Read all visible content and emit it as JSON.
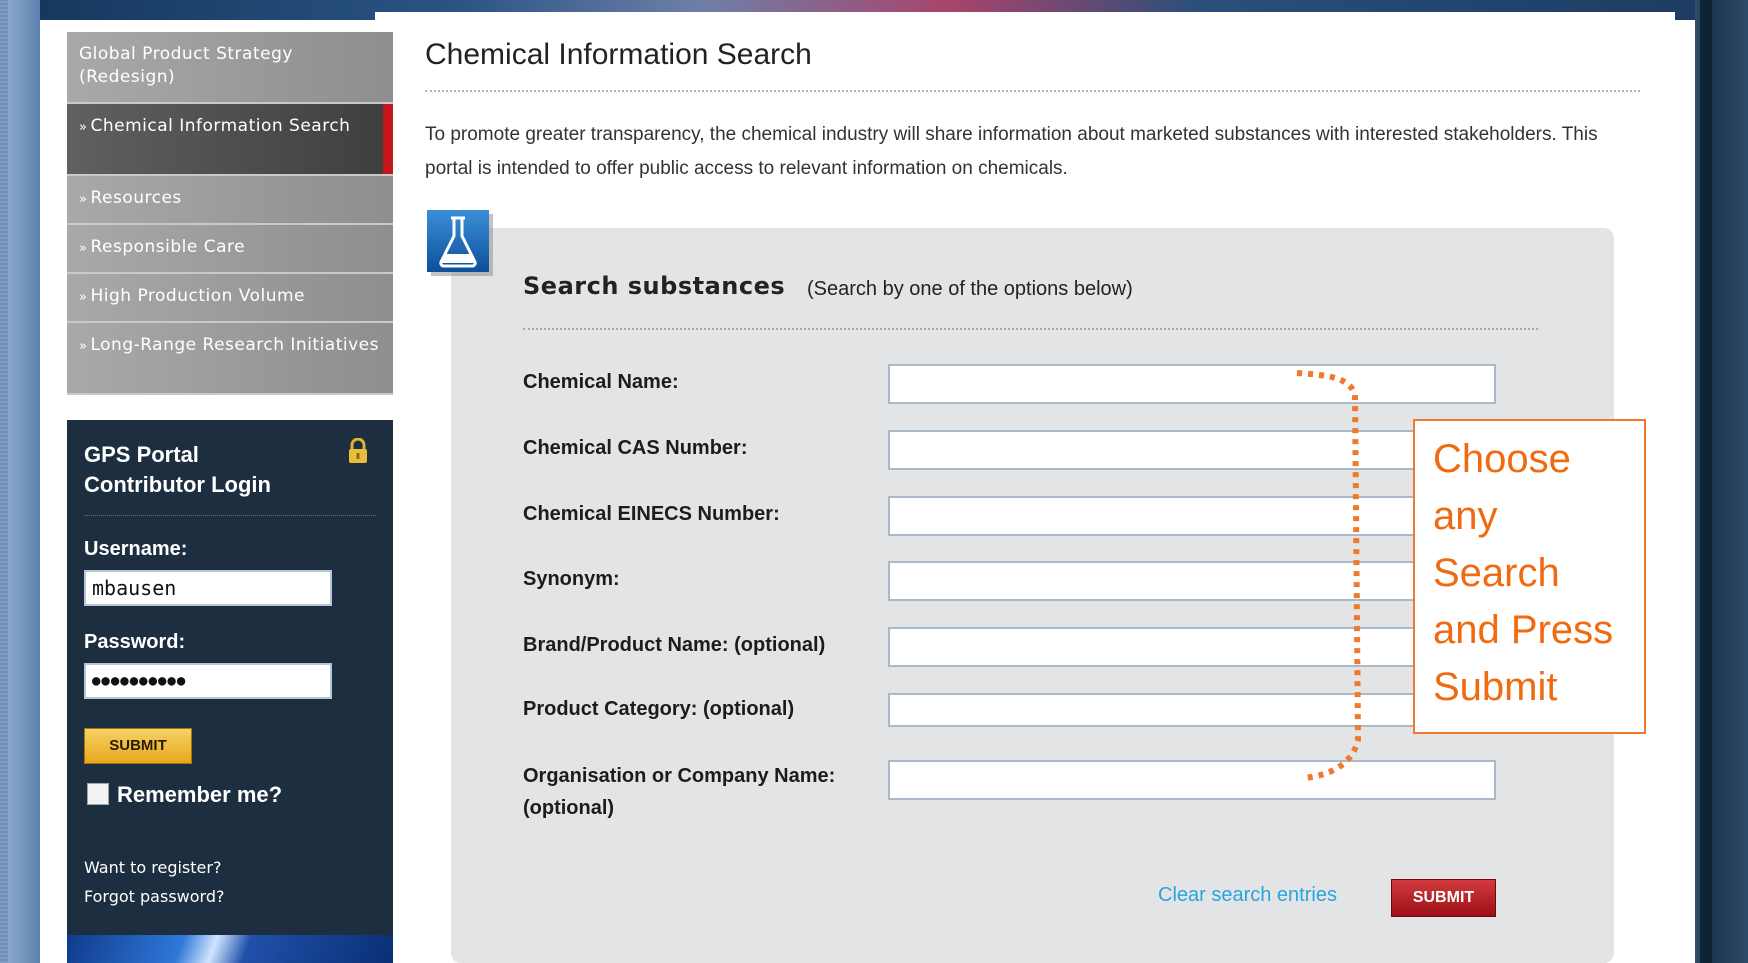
{
  "nav": {
    "items": [
      {
        "label": "Global Product Strategy (Redesign)",
        "arrow": false,
        "active": false
      },
      {
        "label": "Chemical Information Search",
        "arrow": true,
        "active": true
      },
      {
        "label": "Resources",
        "arrow": true,
        "active": false
      },
      {
        "label": "Responsible Care",
        "arrow": true,
        "active": false
      },
      {
        "label": "High Production Volume",
        "arrow": true,
        "active": false
      },
      {
        "label": "Long-Range Research Initiatives",
        "arrow": true,
        "active": false
      }
    ]
  },
  "login": {
    "title_line1": "GPS Portal",
    "title_line2": "Contributor Login",
    "username_label": "Username:",
    "username_value": "mbausen",
    "password_label": "Password:",
    "password_value": "●●●●●●●●●●",
    "submit_label": "SUBMIT",
    "remember_label": "Remember me?",
    "register_link": "Want to register?",
    "forgot_link": "Forgot password?"
  },
  "main": {
    "title": "Chemical Information Search",
    "intro": "To promote greater transparency, the chemical industry will share information about marketed substances with interested stakeholders. This portal is intended to offer public access to relevant information on chemicals.",
    "panel_title": "Search substances",
    "panel_subtitle": "(Search by one of the options below)",
    "fields": [
      {
        "label": "Chemical Name:",
        "value": ""
      },
      {
        "label": "Chemical CAS Number:",
        "value": ""
      },
      {
        "label": "Chemical EINECS Number:",
        "value": ""
      },
      {
        "label": "Synonym:",
        "value": ""
      },
      {
        "label": "Brand/Product Name: (optional)",
        "value": ""
      },
      {
        "label": "Product Category: (optional)",
        "value": ""
      },
      {
        "label": "Organisation or Company Name:",
        "label_line2": "(optional)",
        "value": ""
      }
    ],
    "clear_label": "Clear search entries",
    "submit_label": "SUBMIT"
  },
  "annotation": {
    "text_lines": [
      "Choose",
      "any",
      "Search",
      "and Press",
      "Submit"
    ],
    "color": "#f07a2b"
  },
  "colors": {
    "active_nav_marker": "#c4161c",
    "login_bg": "#1d2e41",
    "link": "#29a5d9",
    "submit_red": "#b51c22",
    "submit_gold": "#f0bd3c"
  }
}
